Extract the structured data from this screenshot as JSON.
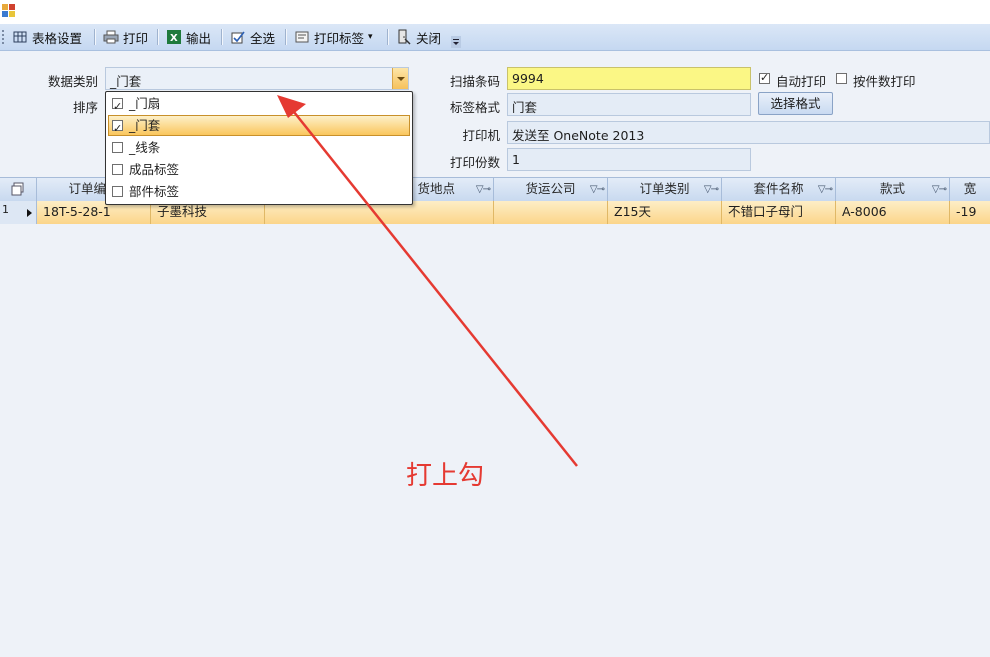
{
  "toolbar": {
    "items": [
      {
        "label": "表格设置",
        "icon": "grid-settings-icon"
      },
      {
        "label": "打印",
        "icon": "printer-icon"
      },
      {
        "label": "输出",
        "icon": "excel-icon"
      },
      {
        "label": "全选",
        "icon": "select-all-icon"
      },
      {
        "label": "打印标签",
        "icon": "label-icon",
        "dropdown_arrow": "▾"
      },
      {
        "label": "关闭",
        "icon": "close-door-icon"
      }
    ]
  },
  "form": {
    "data_type_label": "数据类别",
    "data_type_value": "_门套",
    "sort_label": "排序",
    "scan_label": "扫描条码",
    "scan_value": "9994",
    "auto_print_label": "自动打印",
    "auto_print_checked": true,
    "print_by_count_label": "按件数打印",
    "print_by_count_checked": false,
    "label_format_label": "标签格式",
    "label_format_value": "门套",
    "choose_format_label": "选择格式",
    "printer_label": "打印机",
    "printer_value": "发送至 OneNote 2013",
    "copies_label": "打印份数",
    "copies_value": "1"
  },
  "dropdown": {
    "items": [
      {
        "label": "_门扇",
        "checked": true,
        "selected": false
      },
      {
        "label": "_门套",
        "checked": true,
        "selected": true
      },
      {
        "label": "_线条",
        "checked": false,
        "selected": false
      },
      {
        "label": "成品标签",
        "checked": false,
        "selected": false
      },
      {
        "label": "部件标签",
        "checked": false,
        "selected": false
      }
    ]
  },
  "grid": {
    "columns": [
      "订单编号",
      "货地点",
      "货运公司",
      "订单类别",
      "套件名称",
      "款式",
      "宽"
    ],
    "filter_glyph": "▽⊸",
    "rows": [
      {
        "index": "1",
        "cells": [
          "18T-5-28-1",
          "子墨科技",
          "",
          "",
          "Z15天",
          "不错口子母门",
          "A-8006",
          "-19"
        ]
      }
    ]
  },
  "annotation": {
    "text": "打上勾",
    "color": "#e53a32"
  },
  "colors": {
    "toolbar": "#c5d8f1",
    "scan_highlight": "#fbf785",
    "selection": "#fac65d"
  }
}
